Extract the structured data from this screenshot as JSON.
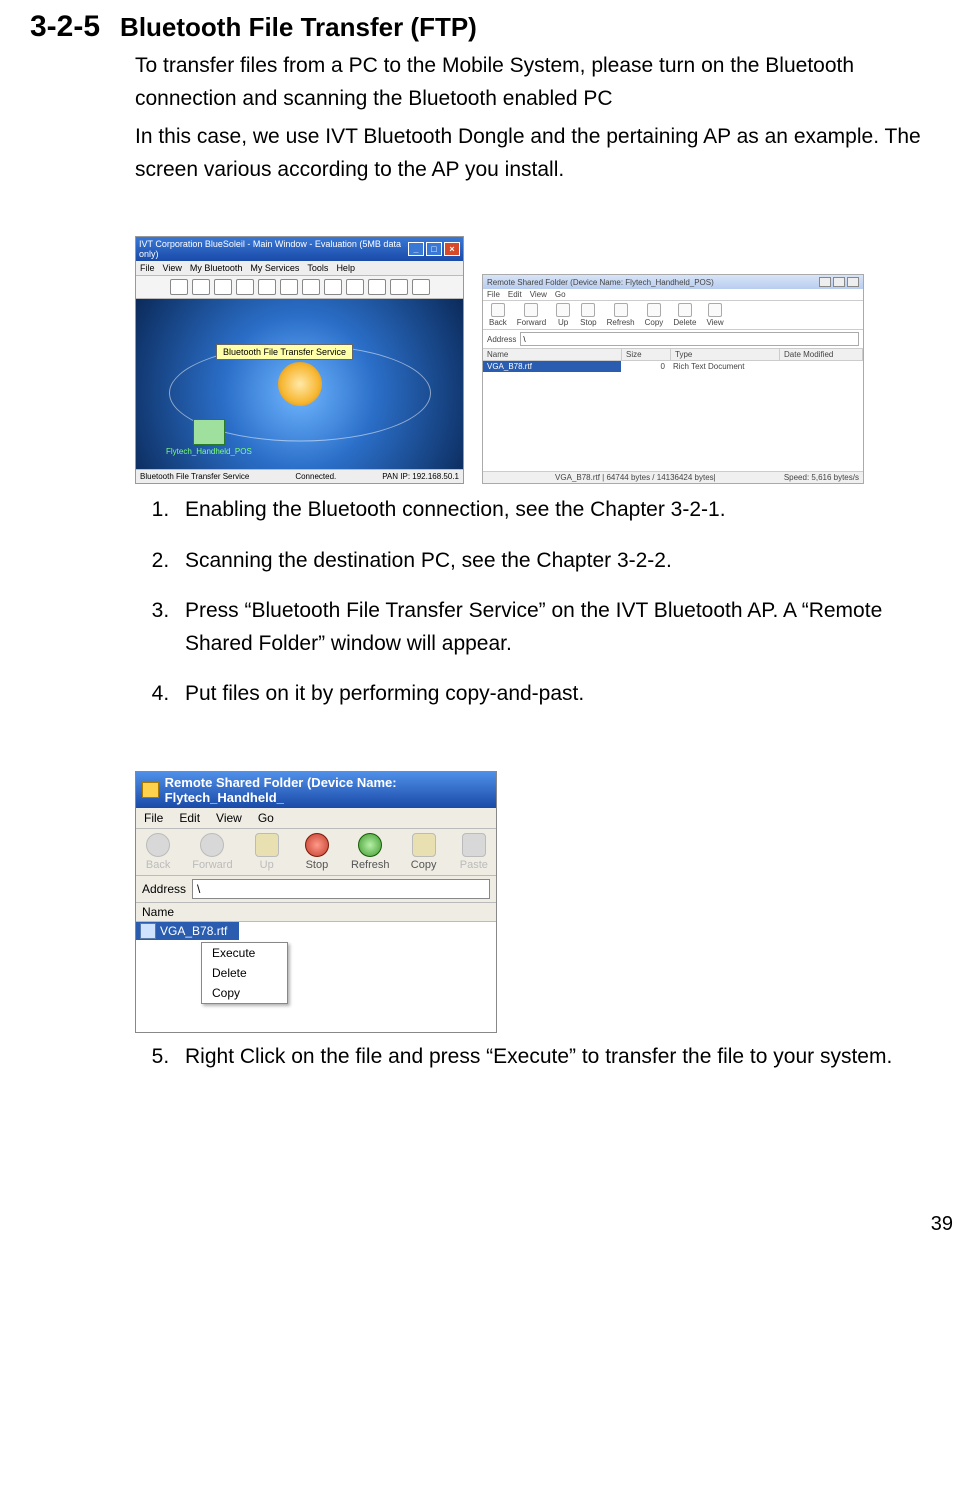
{
  "section": {
    "number": "3-2-5",
    "title": "Bluetooth File Transfer (FTP)"
  },
  "intro": {
    "p1": "To transfer files from a PC to the Mobile System, please turn on the Bluetooth connection and scanning the Bluetooth enabled PC",
    "p2": "In this case, we use IVT Bluetooth Dongle and the pertaining AP as an example. The screen various according to the AP you install."
  },
  "fig1": {
    "title": "IVT Corporation BlueSoleil - Main Window - Evaluation (5MB data only)",
    "menus": [
      "File",
      "View",
      "My Bluetooth",
      "My Services",
      "Tools",
      "Help"
    ],
    "tooltip": "Bluetooth File Transfer Service",
    "node_label": "Flytech_Handheld_POS",
    "status_left": "Bluetooth File Transfer Service",
    "status_mid": "Connected.",
    "status_right": "PAN IP: 192.168.50.1"
  },
  "fig2": {
    "title": "Remote Shared Folder (Device Name: Flytech_Handheld_POS)",
    "menus": [
      "File",
      "Edit",
      "View",
      "Go"
    ],
    "toolbar": [
      "Back",
      "Forward",
      "Up",
      "Stop",
      "Refresh",
      "Copy",
      "Delete",
      "View"
    ],
    "addr_label": "Address",
    "addr_value": "\\",
    "cols": [
      "Name",
      "Size",
      "Type",
      "Date Modified"
    ],
    "row_name": "VGA_B78.rtf",
    "row_size": "0",
    "row_type": "Rich Text Document",
    "status_left": "",
    "status_mid": "VGA_B78.rtf | 64744 bytes / 14136424 bytes|",
    "status_right": "Speed: 5,616 bytes/s"
  },
  "steps_a": [
    "Enabling the Bluetooth connection, see the Chapter 3-2-1.",
    "Scanning the destination PC, see the Chapter 3-2-2.",
    "Press “Bluetooth File Transfer Service” on the IVT Bluetooth AP. A “Remote Shared Folder” window will appear.",
    "Put files on it by performing copy-and-past."
  ],
  "fig3": {
    "title": "Remote Shared Folder (Device Name: Flytech_Handheld_",
    "menus": [
      "File",
      "Edit",
      "View",
      "Go"
    ],
    "toolbar": [
      {
        "label": "Back",
        "cls": "arrow",
        "disabled": true
      },
      {
        "label": "Forward",
        "cls": "arrow",
        "disabled": true
      },
      {
        "label": "Up",
        "cls": "up",
        "disabled": true
      },
      {
        "label": "Stop",
        "cls": "stop",
        "disabled": false
      },
      {
        "label": "Refresh",
        "cls": "refresh",
        "disabled": false
      },
      {
        "label": "Copy",
        "cls": "copy",
        "disabled": false
      },
      {
        "label": "Paste",
        "cls": "paste",
        "disabled": true
      }
    ],
    "addr_label": "Address",
    "addr_value": "\\",
    "col_name": "Name",
    "file_name": "VGA_B78.rtf",
    "context": [
      "Execute",
      "Delete",
      "Copy"
    ]
  },
  "steps_b": [
    "Right Click on the file and press “Execute” to transfer the file to your system."
  ],
  "page_number": "39"
}
